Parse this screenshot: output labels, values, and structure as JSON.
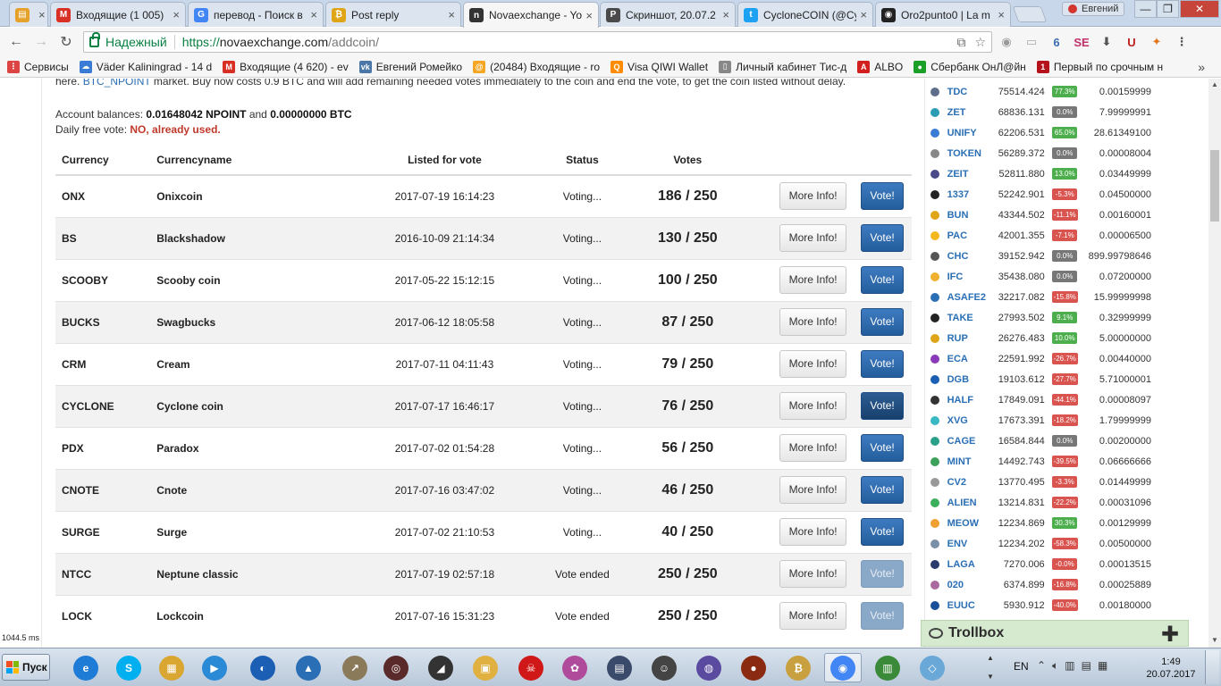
{
  "tabs": [
    {
      "title": "",
      "color": "#e6a12a",
      "glyph": "▤"
    },
    {
      "title": "Входящие (1 005)",
      "color": "#d93025",
      "glyph": "M"
    },
    {
      "title": "перевод - Поиск в",
      "color": "#4285f4",
      "glyph": "G"
    },
    {
      "title": "Post reply",
      "color": "#e0a516",
      "glyph": "₿"
    },
    {
      "title": "Novaexchange - Yo",
      "color": "#333333",
      "glyph": "n"
    },
    {
      "title": "Скриншот, 20.07.2",
      "color": "#4a4a4a",
      "glyph": "P"
    },
    {
      "title": "CycloneCOIN (@Cy",
      "color": "#1da1f2",
      "glyph": "t"
    },
    {
      "title": "Oro2punto0 | La m",
      "color": "#222222",
      "glyph": "◉"
    }
  ],
  "profile": {
    "name": "Евгений"
  },
  "window_controls": {
    "minimize": "—",
    "maximize": "❐",
    "close": "✕"
  },
  "omnibox": {
    "secure_label": "Надежный",
    "url_scheme": "https://",
    "url_host": "novaexchange.com",
    "url_path": "/addcoin/"
  },
  "extensions": [
    {
      "glyph": "◉",
      "color": "#999999"
    },
    {
      "glyph": "▭",
      "color": "#aaaaaa"
    },
    {
      "glyph": "6",
      "color": "#3b6db3"
    },
    {
      "glyph": "SE",
      "color": "#c0306a"
    },
    {
      "glyph": "⬇",
      "color": "#555555"
    },
    {
      "glyph": "U",
      "color": "#c02020"
    },
    {
      "glyph": "✦",
      "color": "#e2761b"
    },
    {
      "glyph": "⋮",
      "color": "#555555"
    }
  ],
  "bookmarks": [
    {
      "label": "Сервисы",
      "color": "#d44",
      "glyph": "⋮"
    },
    {
      "label": "Väder Kaliningrad - 14 d",
      "color": "#3a7bd5",
      "glyph": "☁"
    },
    {
      "label": "Входящие (4 620) - ev",
      "color": "#d93025",
      "glyph": "M"
    },
    {
      "label": "Евгений Ромейко",
      "color": "#4a76a8",
      "glyph": "vk"
    },
    {
      "label": "(20484) Входящие - ro",
      "color": "#f5a623",
      "glyph": "@"
    },
    {
      "label": "Visa QIWI Wallet",
      "color": "#ff8c00",
      "glyph": "Q"
    },
    {
      "label": "Личный кабинет Тис-д",
      "color": "#888888",
      "glyph": "▯"
    },
    {
      "label": "ALBO",
      "color": "#d21f1f",
      "glyph": "A"
    },
    {
      "label": "Сбербанк ОнЛ@йн",
      "color": "#1a9f29",
      "glyph": "●"
    },
    {
      "label": "Первый по срочным н",
      "color": "#b5121b",
      "glyph": "1"
    }
  ],
  "bookmarks_more": "»",
  "intro": {
    "text_before": "here.",
    "link": "BTC_NPOINT",
    "text_after": "market. Buy now costs 0.9 BTC and will add remaining needed votes immediately to the coin and end the vote, to get the coin listed without delay."
  },
  "account": {
    "label": "Account balances:",
    "npoint": "0.01648042 NPOINT",
    "and": "and",
    "btc": "0.00000000 BTC",
    "free_vote_label": "Daily free vote:",
    "free_vote_value": "NO, already used."
  },
  "table": {
    "headers": {
      "currency": "Currency",
      "currencyname": "Currencyname",
      "listed": "Listed for vote",
      "status": "Status",
      "votes": "Votes"
    },
    "more_info_label": "More Info!",
    "vote_label": "Vote!",
    "rows": [
      {
        "symbol": "ONX",
        "name": "Onixcoin",
        "listed": "2017-07-19 16:14:23",
        "status": "Voting...",
        "votes": "186 / 250",
        "vote_enabled": true
      },
      {
        "symbol": "BS",
        "name": "Blackshadow",
        "listed": "2016-10-09 21:14:34",
        "status": "Voting...",
        "votes": "130 / 250",
        "vote_enabled": true
      },
      {
        "symbol": "SCOOBY",
        "name": "Scooby coin",
        "listed": "2017-05-22 15:12:15",
        "status": "Voting...",
        "votes": "100 / 250",
        "vote_enabled": true
      },
      {
        "symbol": "BUCKS",
        "name": "Swagbucks",
        "listed": "2017-06-12 18:05:58",
        "status": "Voting...",
        "votes": "87 / 250",
        "vote_enabled": true
      },
      {
        "symbol": "CRM",
        "name": "Cream",
        "listed": "2017-07-11 04:11:43",
        "status": "Voting...",
        "votes": "79 / 250",
        "vote_enabled": true
      },
      {
        "symbol": "CYCLONE",
        "name": "Cyclone coin",
        "listed": "2017-07-17 16:46:17",
        "status": "Voting...",
        "votes": "76 / 250",
        "vote_enabled": true,
        "hover": true
      },
      {
        "symbol": "PDX",
        "name": "Paradox",
        "listed": "2017-07-02 01:54:28",
        "status": "Voting...",
        "votes": "56 / 250",
        "vote_enabled": true
      },
      {
        "symbol": "CNOTE",
        "name": "Cnote",
        "listed": "2017-07-16 03:47:02",
        "status": "Voting...",
        "votes": "46 / 250",
        "vote_enabled": true
      },
      {
        "symbol": "SURGE",
        "name": "Surge",
        "listed": "2017-07-02 21:10:53",
        "status": "Voting...",
        "votes": "40 / 250",
        "vote_enabled": true
      },
      {
        "symbol": "NTCC",
        "name": "Neptune classic",
        "listed": "2017-07-19 02:57:18",
        "status": "Vote ended",
        "votes": "250 / 250",
        "vote_enabled": false
      },
      {
        "symbol": "LOCK",
        "name": "Lockcoin",
        "listed": "2017-07-16 15:31:23",
        "status": "Vote ended",
        "votes": "250 / 250",
        "vote_enabled": false
      }
    ]
  },
  "load_time": "1044.5 ms",
  "markets": [
    {
      "symbol": "TDC",
      "volume": "75514.424",
      "change": "77.3%",
      "positive": true,
      "price": "0.00159999",
      "color": "#5d6d8a"
    },
    {
      "symbol": "ZET",
      "volume": "68836.131",
      "change": "0.0%",
      "positive": null,
      "price": "7.99999991",
      "color": "#2a9db5"
    },
    {
      "symbol": "UNIFY",
      "volume": "62206.531",
      "change": "65.0%",
      "positive": true,
      "price": "28.61349100",
      "color": "#3a7bd5"
    },
    {
      "symbol": "TOKEN",
      "volume": "56289.372",
      "change": "0.0%",
      "positive": null,
      "price": "0.00008004",
      "color": "#888888"
    },
    {
      "symbol": "ZEIT",
      "volume": "52811.880",
      "change": "13.0%",
      "positive": true,
      "price": "0.03449999",
      "color": "#4a4a8a"
    },
    {
      "symbol": "1337",
      "volume": "52242.901",
      "change": "-5.3%",
      "positive": false,
      "price": "0.04500000",
      "color": "#222222"
    },
    {
      "symbol": "BUN",
      "volume": "43344.502",
      "change": "-11.1%",
      "positive": false,
      "price": "0.00160001",
      "color": "#e0a516"
    },
    {
      "symbol": "PAC",
      "volume": "42001.355",
      "change": "-7.1%",
      "positive": false,
      "price": "0.00006500",
      "color": "#f5b820"
    },
    {
      "symbol": "CHC",
      "volume": "39152.942",
      "change": "0.0%",
      "positive": null,
      "price": "899.99798646",
      "color": "#555555"
    },
    {
      "symbol": "IFC",
      "volume": "35438.080",
      "change": "0.0%",
      "positive": null,
      "price": "0.07200000",
      "color": "#f0b030"
    },
    {
      "symbol": "ASAFE2",
      "volume": "32217.082",
      "change": "-15.8%",
      "positive": false,
      "price": "15.99999998",
      "color": "#2a6fb5"
    },
    {
      "symbol": "TAKE",
      "volume": "27993.502",
      "change": "9.1%",
      "positive": true,
      "price": "0.32999999",
      "color": "#222222"
    },
    {
      "symbol": "RUP",
      "volume": "26276.483",
      "change": "10.0%",
      "positive": true,
      "price": "5.00000000",
      "color": "#e0a516"
    },
    {
      "symbol": "ECA",
      "volume": "22591.992",
      "change": "-26.7%",
      "positive": false,
      "price": "0.00440000",
      "color": "#8a3ab9"
    },
    {
      "symbol": "DGB",
      "volume": "19103.612",
      "change": "-27.7%",
      "positive": false,
      "price": "5.71000001",
      "color": "#1a5fb4"
    },
    {
      "symbol": "HALF",
      "volume": "17849.091",
      "change": "-44.1%",
      "positive": false,
      "price": "0.00008097",
      "color": "#333333"
    },
    {
      "symbol": "XVG",
      "volume": "17673.391",
      "change": "-18.2%",
      "positive": false,
      "price": "1.79999999",
      "color": "#39b8c4"
    },
    {
      "symbol": "CAGE",
      "volume": "16584.844",
      "change": "0.0%",
      "positive": null,
      "price": "0.00200000",
      "color": "#2aa08a"
    },
    {
      "symbol": "MINT",
      "volume": "14492.743",
      "change": "-39.5%",
      "positive": false,
      "price": "0.06666666",
      "color": "#3aa05a"
    },
    {
      "symbol": "CV2",
      "volume": "13770.495",
      "change": "-3.3%",
      "positive": false,
      "price": "0.01449999",
      "color": "#999999"
    },
    {
      "symbol": "ALIEN",
      "volume": "13214.831",
      "change": "-22.2%",
      "positive": false,
      "price": "0.00031096",
      "color": "#3ab05a"
    },
    {
      "symbol": "MEOW",
      "volume": "12234.869",
      "change": "30.3%",
      "positive": true,
      "price": "0.00129999",
      "color": "#f0a030"
    },
    {
      "symbol": "ENV",
      "volume": "12234.202",
      "change": "-58.3%",
      "positive": false,
      "price": "0.00500000",
      "color": "#7a8fa8"
    },
    {
      "symbol": "LAGA",
      "volume": "7270.006",
      "change": "-0.0%",
      "positive": false,
      "price": "0.00013515",
      "color": "#2a3a6a"
    },
    {
      "symbol": "020",
      "volume": "6374.899",
      "change": "-16.8%",
      "positive": false,
      "price": "0.00025889",
      "color": "#aa6aa0"
    },
    {
      "symbol": "EUUC",
      "volume": "5930.912",
      "change": "-40.0%",
      "positive": false,
      "price": "0.00180000",
      "color": "#1a4f9a"
    }
  ],
  "colors": {
    "positive": "#4cae4c",
    "negative": "#d9534f",
    "neutral": "#777777"
  },
  "trollbox": {
    "label": "Trollbox",
    "plus": "✚"
  },
  "taskbar": {
    "start_label": "Пуск",
    "apps": [
      {
        "glyph": "e",
        "color": "#1e7bd6"
      },
      {
        "glyph": "S",
        "color": "#00aff0"
      },
      {
        "glyph": "▦",
        "color": "#d9a632"
      },
      {
        "glyph": "▶",
        "color": "#2a8ad6"
      },
      {
        "glyph": "◐",
        "color": "#1a5fb4"
      },
      {
        "glyph": "▲",
        "color": "#2a6fb5"
      },
      {
        "glyph": "↗",
        "color": "#8a7a5a"
      },
      {
        "glyph": "◎",
        "color": "#5a2a2a"
      },
      {
        "glyph": "◢",
        "color": "#333333"
      },
      {
        "glyph": "▣",
        "color": "#e0b040"
      },
      {
        "glyph": "☠",
        "color": "#d01818"
      },
      {
        "glyph": "✿",
        "color": "#b04a9a"
      },
      {
        "glyph": "▤",
        "color": "#3a4a6a"
      },
      {
        "glyph": "☺",
        "color": "#444444"
      },
      {
        "glyph": "◍",
        "color": "#5a4aa0"
      },
      {
        "glyph": "●",
        "color": "#8a2a10"
      },
      {
        "glyph": "₿",
        "color": "#c8a040"
      },
      {
        "glyph": "◉",
        "color": "#4285f4"
      },
      {
        "glyph": "▥",
        "color": "#3a8a3a"
      },
      {
        "glyph": "◇",
        "color": "#6aa8d8"
      }
    ],
    "language": "EN",
    "clock_time": "1:49",
    "clock_date": "20.07.2017"
  }
}
